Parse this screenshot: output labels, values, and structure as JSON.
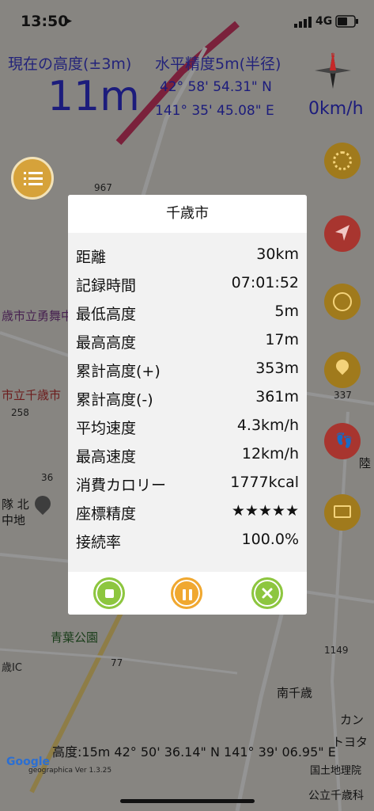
{
  "status": {
    "time": "13:50",
    "network": "4G"
  },
  "header": {
    "altitude_label": "現在の高度(±3m)",
    "accuracy_label": "水平精度5m(半径)",
    "altitude": "11m",
    "latitude": "42° 58' 54.31\" N",
    "longitude": "141° 35' 45.08\" E",
    "speed": "0km/h"
  },
  "map_labels": {
    "route_967": "967",
    "school": "歳市立勇舞中",
    "city_office": "市立千歳市",
    "route_258": "258",
    "route_36": "36",
    "unit": "隊 北",
    "base": "中地",
    "park": "青葉公園",
    "route_77": "77",
    "ic": "歳IC",
    "route_1149": "1149",
    "south_chitose": "南千歳",
    "route_337": "337",
    "riku": "陸",
    "toyota": "トヨタ",
    "kan": "カン",
    "school_bottom": "公立千歳科"
  },
  "dialog": {
    "title": "千歳市",
    "rows": [
      {
        "label": "距離",
        "value": "30km"
      },
      {
        "label": "記録時間",
        "value": "07:01:52"
      },
      {
        "label": "最低高度",
        "value": "5m"
      },
      {
        "label": "最高高度",
        "value": "17m"
      },
      {
        "label": "累計高度(+)",
        "value": "353m"
      },
      {
        "label": "累計高度(-)",
        "value": "361m"
      },
      {
        "label": "平均速度",
        "value": "4.3km/h"
      },
      {
        "label": "最高速度",
        "value": "12km/h"
      },
      {
        "label": "消費カロリー",
        "value": "1777kcal"
      },
      {
        "label": "座標精度",
        "value": "★★★★★"
      },
      {
        "label": "接続率",
        "value": "100.0%"
      }
    ]
  },
  "footer": {
    "cursor_info": "高度:15m  42° 50' 36.14\" N 141° 39' 06.95\" E",
    "google": "Google",
    "version": "geographica Ver 1.3.25",
    "credit": "国土地理院"
  },
  "colors": {
    "stop": "#8dc63f",
    "pause": "#f0a830",
    "close": "#8dc63f",
    "nav": "#e03a3a",
    "header_text": "#1c1c7c"
  }
}
